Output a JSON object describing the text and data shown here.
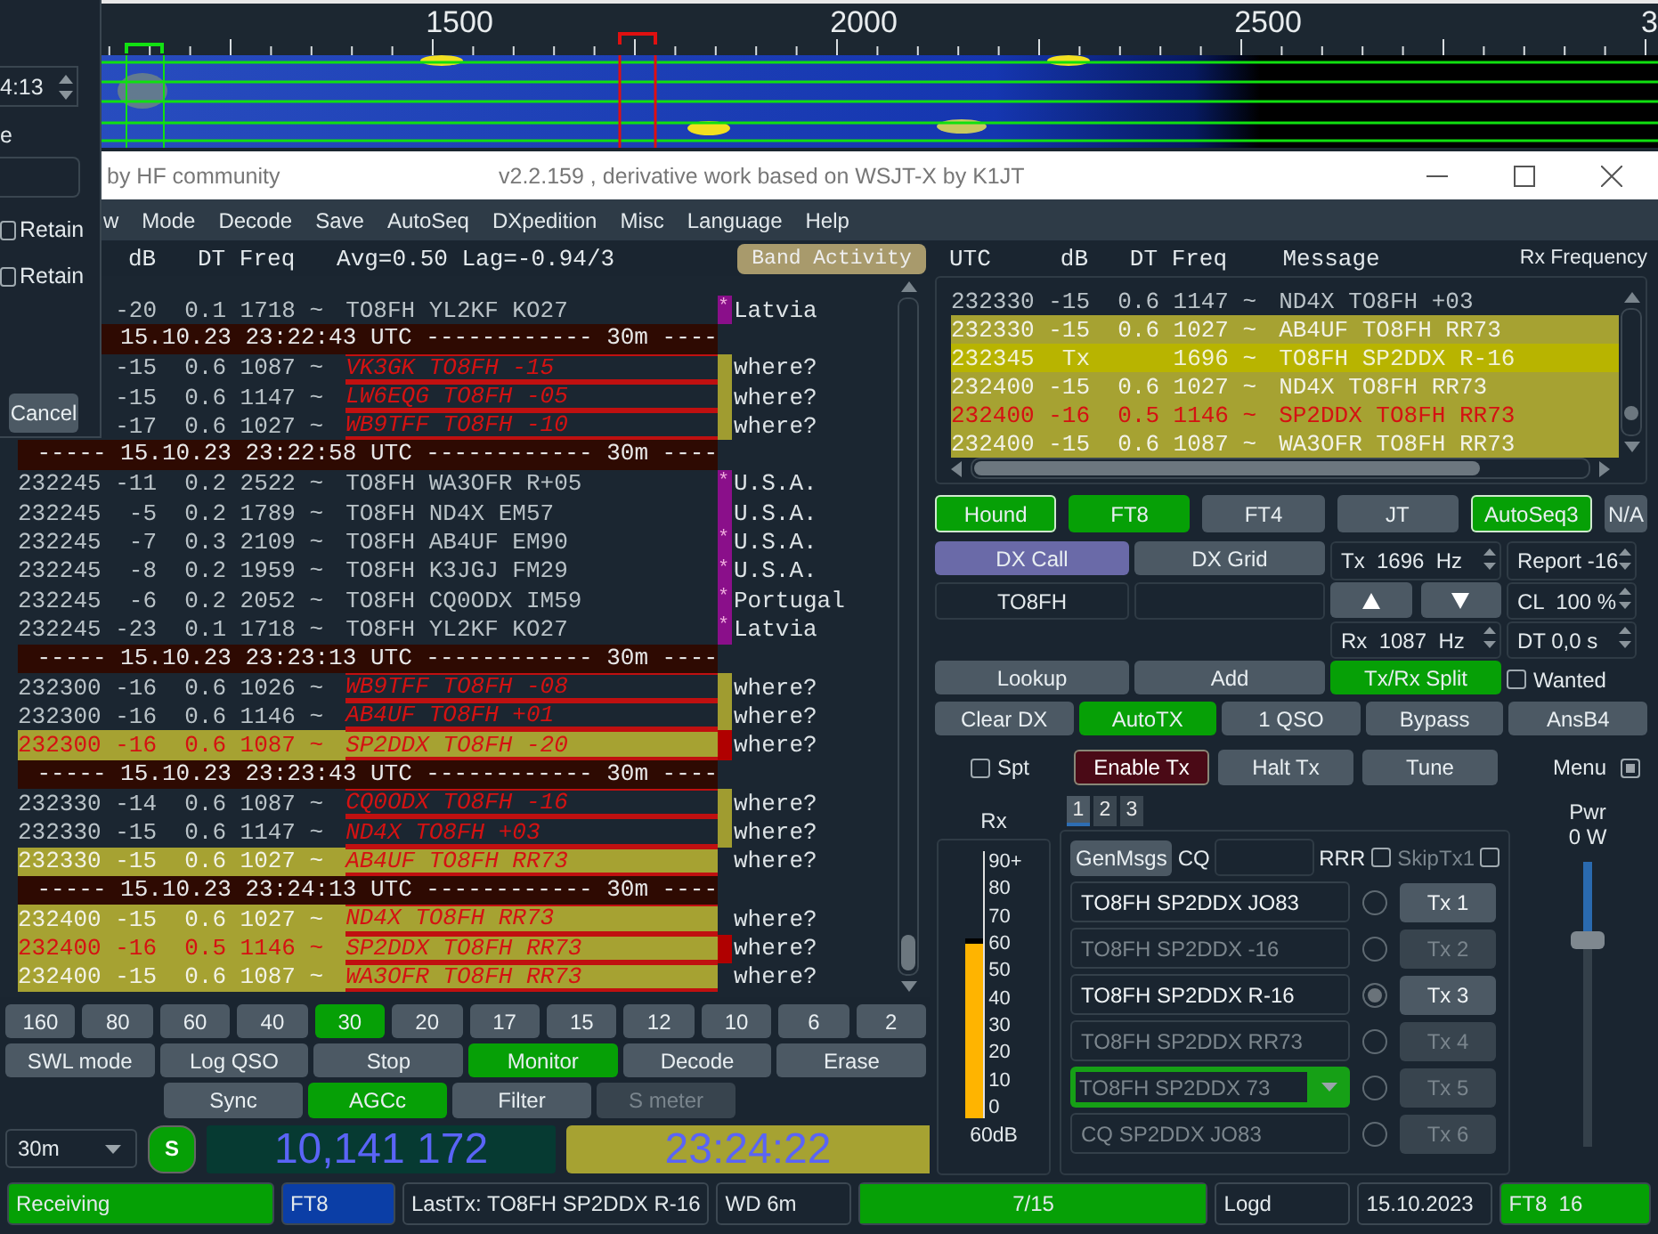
{
  "waterfall": {
    "scale_labels": [
      "1500",
      "2000",
      "2500",
      "3"
    ]
  },
  "dialog": {
    "time_value": "4:13",
    "label": "e",
    "checkboxes": [
      {
        "label": "Retain",
        "checked": false
      },
      {
        "label": "Retain",
        "checked": false
      }
    ],
    "cancel_button": "Cancel"
  },
  "window": {
    "subtitle": "by HF community",
    "title": "v2.2.159 , derivative work based on WSJT-X by K1JT"
  },
  "menu": [
    "w",
    "Mode",
    "Decode",
    "Save",
    "AutoSeq",
    "DXpedition",
    "Misc",
    "Language",
    "Help"
  ],
  "band_activity": {
    "header": "dB   DT Freq   Avg=0.50 Lag=-0.94/3",
    "button": "Band Activity",
    "rows": [
      {
        "kind": "decode",
        "db": "-20",
        "dt": "0.1",
        "freq": "1718",
        "mark": "~",
        "message": "TO8FH YL2KF KO27",
        "flag": "*",
        "color": "#8a0f8a",
        "country": "Latvia",
        "highlighted": false,
        "dx_call": false,
        "my_call": false
      },
      {
        "kind": "separator",
        "text": "15.10.23 23:22:43 UTC ------------ 30m ----"
      },
      {
        "kind": "decode",
        "db": "-15",
        "dt": "0.6",
        "freq": "1087",
        "mark": "~",
        "message": "VK3GK TO8FH -15",
        "color": "#a09c30",
        "country": "where?",
        "highlighted": false,
        "dx_call": true,
        "my_call": false
      },
      {
        "kind": "decode",
        "db": "-15",
        "dt": "0.6",
        "freq": "1147",
        "mark": "~",
        "message": "LW6EQG TO8FH -05",
        "color": "#a09c30",
        "country": "where?",
        "highlighted": false,
        "dx_call": true,
        "my_call": false
      },
      {
        "kind": "decode",
        "db": "-17",
        "dt": "0.6",
        "freq": "1027",
        "mark": "~",
        "message": "WB9TFF TO8FH -10",
        "color": "#a09c30",
        "country": "where?",
        "highlighted": false,
        "dx_call": true,
        "my_call": false
      },
      {
        "kind": "separator",
        "text": "----- 15.10.23 23:22:58 UTC ------------ 30m ----"
      },
      {
        "kind": "decode",
        "utc": "232245",
        "db": "-11",
        "dt": "0.2",
        "freq": "2522",
        "mark": "~",
        "message": "TO8FH WA3OFR R+05",
        "flag": "*",
        "color": "#8a0f8a",
        "country": "U.S.A.",
        "highlighted": false,
        "dx_call": false,
        "my_call": false
      },
      {
        "kind": "decode",
        "utc": "232245",
        "db": "-5",
        "dt": "0.2",
        "freq": "1789",
        "mark": "~",
        "message": "TO8FH ND4X EM57",
        "color": "#8a0f8a",
        "country": "U.S.A.",
        "highlighted": false,
        "dx_call": false,
        "my_call": false
      },
      {
        "kind": "decode",
        "utc": "232245",
        "db": "-7",
        "dt": "0.3",
        "freq": "2109",
        "mark": "~",
        "message": "TO8FH AB4UF EM90",
        "flag": "*",
        "color": "#8a0f8a",
        "country": "U.S.A.",
        "highlighted": false,
        "dx_call": false,
        "my_call": false
      },
      {
        "kind": "decode",
        "utc": "232245",
        "db": "-8",
        "dt": "0.2",
        "freq": "1959",
        "mark": "~",
        "message": "TO8FH K3JGJ FM29",
        "flag": "*",
        "color": "#8a0f8a",
        "country": "U.S.A.",
        "highlighted": false,
        "dx_call": false,
        "my_call": false
      },
      {
        "kind": "decode",
        "utc": "232245",
        "db": "-6",
        "dt": "0.2",
        "freq": "2052",
        "mark": "~",
        "message": "TO8FH CQ0ODX IM59",
        "flag": "*",
        "color": "#8a0f8a",
        "country": "Portugal",
        "highlighted": false,
        "dx_call": false,
        "my_call": false
      },
      {
        "kind": "decode",
        "utc": "232245",
        "db": "-23",
        "dt": "0.1",
        "freq": "1718",
        "mark": "~",
        "message": "TO8FH YL2KF KO27",
        "flag": "*",
        "color": "#8a0f8a",
        "country": "Latvia",
        "highlighted": false,
        "dx_call": false,
        "my_call": false
      },
      {
        "kind": "separator",
        "text": "----- 15.10.23 23:23:13 UTC ------------ 30m ----"
      },
      {
        "kind": "decode",
        "utc": "232300",
        "db": "-16",
        "dt": "0.6",
        "freq": "1026",
        "mark": "~",
        "message": "WB9TFF TO8FH -08",
        "color": "#a09c30",
        "country": "where?",
        "highlighted": false,
        "dx_call": true,
        "my_call": false
      },
      {
        "kind": "decode",
        "utc": "232300",
        "db": "-16",
        "dt": "0.6",
        "freq": "1146",
        "mark": "~",
        "message": "AB4UF TO8FH +01",
        "color": "#a09c30",
        "country": "where?",
        "highlighted": false,
        "dx_call": true,
        "my_call": false
      },
      {
        "kind": "decode",
        "utc": "232300",
        "db": "-16",
        "dt": "0.6",
        "freq": "1087",
        "mark": "~",
        "message": "SP2DDX TO8FH -20",
        "color": "#b00000",
        "country": "where?",
        "highlighted": true,
        "dx_call": true,
        "my_call": true
      },
      {
        "kind": "separator",
        "text": "----- 15.10.23 23:23:43 UTC ------------ 30m ----"
      },
      {
        "kind": "decode",
        "utc": "232330",
        "db": "-14",
        "dt": "0.6",
        "freq": "1087",
        "mark": "~",
        "message": "CQ0ODX TO8FH -16",
        "color": "#a09c30",
        "country": "where?",
        "highlighted": false,
        "dx_call": true,
        "my_call": false
      },
      {
        "kind": "decode",
        "utc": "232330",
        "db": "-15",
        "dt": "0.6",
        "freq": "1147",
        "mark": "~",
        "message": "ND4X TO8FH +03",
        "color": "#a09c30",
        "country": "where?",
        "highlighted": false,
        "dx_call": true,
        "my_call": false
      },
      {
        "kind": "decode",
        "utc": "232330",
        "db": "-15",
        "dt": "0.6",
        "freq": "1027",
        "mark": "~",
        "message": "AB4UF TO8FH RR73",
        "country": "where?",
        "highlighted": true,
        "dx_call": true,
        "my_call": false
      },
      {
        "kind": "separator",
        "text": "----- 15.10.23 23:24:13 UTC ------------ 30m ----"
      },
      {
        "kind": "decode",
        "utc": "232400",
        "db": "-15",
        "dt": "0.6",
        "freq": "1027",
        "mark": "~",
        "message": "ND4X TO8FH RR73",
        "country": "where?",
        "highlighted": true,
        "dx_call": true,
        "my_call": false
      },
      {
        "kind": "decode",
        "utc": "232400",
        "db": "-16",
        "dt": "0.5",
        "freq": "1146",
        "mark": "~",
        "message": "SP2DDX TO8FH RR73",
        "color": "#b00000",
        "country": "where?",
        "highlighted": true,
        "dx_call": true,
        "my_call": true
      },
      {
        "kind": "decode",
        "utc": "232400",
        "db": "-15",
        "dt": "0.6",
        "freq": "1087",
        "mark": "~",
        "message": "WA3OFR TO8FH RR73",
        "country": "where?",
        "highlighted": true,
        "dx_call": true,
        "my_call": false
      }
    ]
  },
  "bands": [
    {
      "label": "160",
      "selected": false
    },
    {
      "label": "80",
      "selected": false
    },
    {
      "label": "60",
      "selected": false
    },
    {
      "label": "40",
      "selected": false
    },
    {
      "label": "30",
      "selected": true
    },
    {
      "label": "20",
      "selected": false
    },
    {
      "label": "17",
      "selected": false
    },
    {
      "label": "15",
      "selected": false
    },
    {
      "label": "12",
      "selected": false
    },
    {
      "label": "10",
      "selected": false
    },
    {
      "label": "6",
      "selected": false
    },
    {
      "label": "2",
      "selected": false
    }
  ],
  "control_buttons": [
    {
      "label": "SWL mode",
      "on": false,
      "disabled": false
    },
    {
      "label": "Log QSO",
      "on": false,
      "disabled": false
    },
    {
      "label": "Stop",
      "on": false,
      "disabled": false
    },
    {
      "label": "Monitor",
      "on": true,
      "disabled": false
    },
    {
      "label": "Decode",
      "on": false,
      "disabled": false
    },
    {
      "label": "Erase",
      "on": false,
      "disabled": false
    }
  ],
  "filter_buttons": [
    {
      "label": "Sync",
      "on": false,
      "disabled": false
    },
    {
      "label": "AGCc",
      "on": true,
      "disabled": false
    },
    {
      "label": "Filter",
      "on": false,
      "disabled": false
    },
    {
      "label": "S meter",
      "on": false,
      "disabled": true
    }
  ],
  "band_select": "30m",
  "s_button": "S",
  "frequency": "10,141 172",
  "clock": "23:24:22",
  "rx_frequency": {
    "header": "UTC     dB   DT Freq    Message",
    "label": "Rx Frequency",
    "rows": [
      {
        "kind": "rx",
        "utc": "232330",
        "db": "-15",
        "dt": "0.6",
        "freq": "1147",
        "mark": "~",
        "message": "ND4X TO8FH +03",
        "highlighted": false,
        "my_call": false
      },
      {
        "kind": "rx",
        "utc": "232330",
        "db": "-15",
        "dt": "0.6",
        "freq": "1027",
        "mark": "~",
        "message": "AB4UF TO8FH RR73",
        "highlighted": true,
        "my_call": false
      },
      {
        "kind": "tx",
        "utc": "232345",
        "db": "Tx",
        "freq": "1696",
        "mark": "~",
        "message": "TO8FH SP2DDX R-16",
        "my_call": false
      },
      {
        "kind": "rx",
        "utc": "232400",
        "db": "-15",
        "dt": "0.6",
        "freq": "1027",
        "mark": "~",
        "message": "ND4X TO8FH RR73",
        "highlighted": true,
        "my_call": false
      },
      {
        "kind": "rx",
        "utc": "232400",
        "db": "-16",
        "dt": "0.5",
        "freq": "1146",
        "mark": "~",
        "message": "SP2DDX TO8FH RR73",
        "highlighted": true,
        "my_call": true
      },
      {
        "kind": "rx",
        "utc": "232400",
        "db": "-15",
        "dt": "0.6",
        "freq": "1087",
        "mark": "~",
        "message": "WA3OFR TO8FH RR73",
        "highlighted": true,
        "my_call": false
      }
    ]
  },
  "mode_buttons": [
    {
      "label": "Hound",
      "on": true,
      "framed": true
    },
    {
      "label": "FT8",
      "on": true,
      "framed": false
    },
    {
      "label": "FT4",
      "on": false,
      "framed": false
    },
    {
      "label": "JT",
      "on": false,
      "framed": false
    },
    {
      "label": "AutoSeq3",
      "on": true,
      "framed": true
    },
    {
      "label": "N/A",
      "on": false,
      "framed": false
    }
  ],
  "dx": {
    "call_button": "DX Call",
    "grid_button": "DX Grid",
    "call": "TO8FH",
    "tx_freq": "Tx  1696  Hz",
    "rx_freq": "Rx  1087  Hz",
    "report": "Report -16",
    "cl": "CL  100 %",
    "dt": "DT 0,0 s",
    "lookup": "Lookup",
    "add": "Add",
    "split": {
      "label": "Tx/Rx Split",
      "on": true
    },
    "wanted": {
      "label": "Wanted",
      "checked": false
    }
  },
  "action_buttons": [
    {
      "label": "Clear DX",
      "on": false
    },
    {
      "label": "AutoTX",
      "on": true
    },
    {
      "label": "1 QSO",
      "on": false
    },
    {
      "label": "Bypass",
      "on": false
    },
    {
      "label": "AnsB4",
      "on": false
    }
  ],
  "spt": {
    "label": "Spt",
    "checked": false
  },
  "enable_tx": "Enable Tx",
  "halt_tx": "Halt Tx",
  "tune": "Tune",
  "menu_toggle": {
    "label": "Menu",
    "checked": true
  },
  "rx_meter": {
    "label": "Rx",
    "level": 0.667,
    "scale": [
      "90+",
      "80",
      "70",
      "60",
      "50",
      "40",
      "30",
      "20",
      "10",
      "0"
    ],
    "reading": "60dB"
  },
  "tabs": [
    {
      "label": "1",
      "selected": true
    },
    {
      "label": "2",
      "selected": false
    },
    {
      "label": "3",
      "selected": false
    }
  ],
  "messages": {
    "gen_button": "GenMsgs",
    "cq_label": "CQ",
    "rrr_label": "RRR",
    "skip": {
      "label": "SkipTx1",
      "checked": false,
      "disabled": true
    },
    "extra_checked": false,
    "rows": [
      {
        "kind": "field",
        "text": "TO8FH SP2DDX JO83",
        "active": true,
        "selected": false,
        "button": "Tx 1"
      },
      {
        "kind": "field",
        "text": "TO8FH SP2DDX -16",
        "active": false,
        "selected": false,
        "button": "Tx 2"
      },
      {
        "kind": "field",
        "text": "TO8FH SP2DDX R-16",
        "active": true,
        "selected": true,
        "button": "Tx 3"
      },
      {
        "kind": "field",
        "text": "TO8FH SP2DDX RR73",
        "active": false,
        "selected": false,
        "button": "Tx 4"
      },
      {
        "kind": "combo",
        "text": "TO8FH SP2DDX 73",
        "active": false,
        "selected": false,
        "button": "Tx 5"
      },
      {
        "kind": "field",
        "text": "CQ SP2DDX JO83",
        "active": false,
        "selected": false,
        "button": "Tx 6"
      }
    ]
  },
  "power": {
    "label": "Pwr",
    "reading": "0 W",
    "level": 0.72
  },
  "status_bar": [
    {
      "kind": "label",
      "text": "Receiving",
      "color": "#05a005"
    },
    {
      "kind": "label",
      "text": "FT8",
      "color": "#0b3ea6"
    },
    {
      "kind": "label",
      "text": "LastTx: TO8FH SP2DDX R-16"
    },
    {
      "kind": "label",
      "text": "WD 6m"
    },
    {
      "kind": "progress",
      "text": "7/15",
      "level": 1
    },
    {
      "kind": "label",
      "text": "Logd"
    },
    {
      "kind": "label",
      "text": "15.10.2023"
    },
    {
      "kind": "label",
      "text": "FT8  16",
      "color": "#05a005"
    }
  ]
}
